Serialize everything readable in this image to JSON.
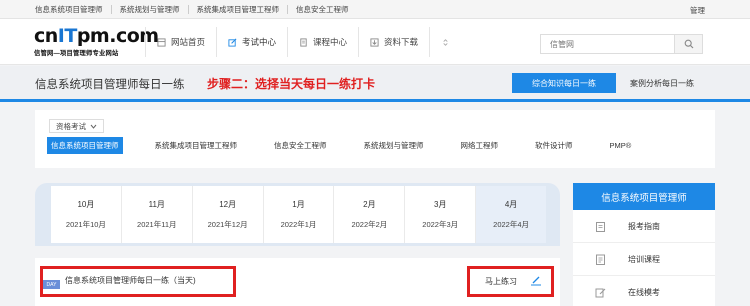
{
  "topbar": {
    "links": [
      "信息系统项目管理师",
      "系统规划与管理师",
      "系统集成项目管理工程师",
      "信息安全工程师"
    ],
    "right_label": "管理"
  },
  "header": {
    "logo_brand_a": "cn",
    "logo_brand_b": "IT",
    "logo_brand_c": "pm.com",
    "logo_tagline": "信管网—项目管理师专业网站",
    "nav": [
      {
        "label": "网站首页",
        "icon": "home-icon"
      },
      {
        "label": "考试中心",
        "icon": "edit-icon"
      },
      {
        "label": "课程中心",
        "icon": "book-icon"
      },
      {
        "label": "资料下载",
        "icon": "download-icon"
      }
    ],
    "search_placeholder": "信管网"
  },
  "titlebar": {
    "title": "信息系统项目管理师每日一练",
    "step": "步骤二：选择当天每日一练打卡",
    "daily_button": "综合知识每日一练",
    "case_link": "案例分析每日一练"
  },
  "filter": {
    "dropdown": "资格考试",
    "tabs": [
      "信息系统项目管理师",
      "系统集成项目管理工程师",
      "信息安全工程师",
      "系统规划与管理师",
      "网络工程师",
      "软件设计师",
      "PMP®"
    ],
    "selected_index": 0
  },
  "months": [
    {
      "month": "10月",
      "label": "2021年10月"
    },
    {
      "month": "11月",
      "label": "2021年11月"
    },
    {
      "month": "12月",
      "label": "2021年12月"
    },
    {
      "month": "1月",
      "label": "2022年1月"
    },
    {
      "month": "2月",
      "label": "2022年2月"
    },
    {
      "month": "3月",
      "label": "2022年3月"
    },
    {
      "month": "4月",
      "label": "2022年4月"
    }
  ],
  "practice": {
    "badge": "DAY",
    "title": "信息系统项目管理师每日一练（当天)",
    "go_label": "马上练习"
  },
  "sidebar": {
    "head": "信息系统项目管理师",
    "items": [
      {
        "label": "报考指南",
        "icon": "clipboard-icon"
      },
      {
        "label": "培训课程",
        "icon": "document-icon"
      },
      {
        "label": "在线模考",
        "icon": "pencil-icon"
      }
    ]
  },
  "colors": {
    "accent": "#1e88e5",
    "highlight": "#e02020"
  }
}
